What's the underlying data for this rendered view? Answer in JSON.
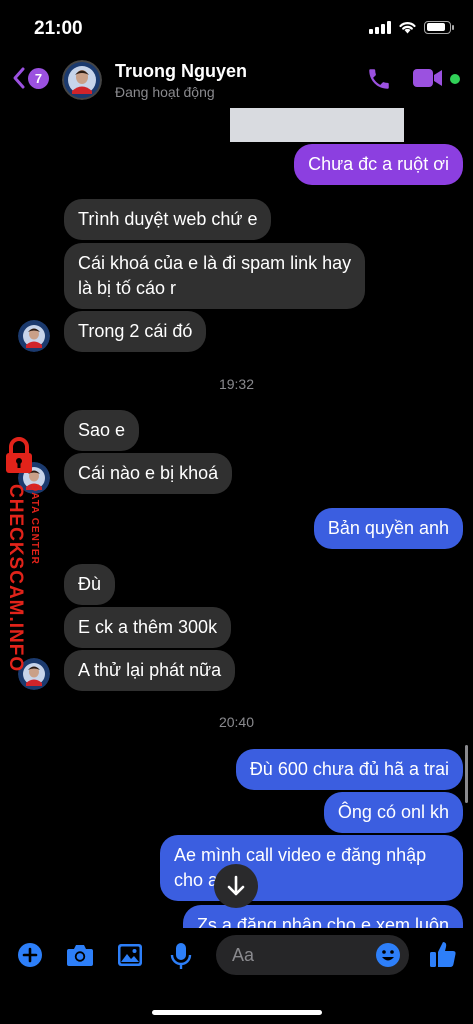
{
  "status_bar": {
    "time": "21:00"
  },
  "header": {
    "unread_count": "7",
    "contact_name": "Truong Nguyen",
    "contact_status": "Đang hoạt động"
  },
  "messages": [
    {
      "dir": "out",
      "color": "#8c3fe0",
      "text": "Chưa đc a ruột ơi"
    },
    {
      "dir": "in",
      "text": "Trình duyệt web chứ e"
    },
    {
      "dir": "in",
      "text": "Cái khoá của e là đi spam link hay",
      "text2": "là bị tố cáo r"
    },
    {
      "dir": "in",
      "text": "Trong 2 cái đó"
    },
    {
      "dir": "time",
      "text": "19:32"
    },
    {
      "dir": "in",
      "text": "Sao e"
    },
    {
      "dir": "in",
      "text": "Cái nào e bị khoá"
    },
    {
      "dir": "out",
      "color": "#3b5ee0",
      "text": "Bản quyền anh"
    },
    {
      "dir": "in",
      "text": "Đù"
    },
    {
      "dir": "in",
      "text": "E ck a thêm 300k"
    },
    {
      "dir": "in",
      "text": "A thử lại phát nữa"
    },
    {
      "dir": "time",
      "text": "20:40"
    },
    {
      "dir": "out",
      "color": "#3b5ee0",
      "text": "Đù 600 chưa đủ hã a trai"
    },
    {
      "dir": "out",
      "color": "#3b5ee0",
      "text": "Ông có onl kh"
    },
    {
      "dir": "out",
      "color": "#3b5ee0",
      "text": "Ae mình call video e đăng nhập",
      "text2": "cho anh"
    },
    {
      "dir": "out",
      "color": "#3b5ee0",
      "text": "Zs a đăng nhập cho e xem luôn"
    }
  ],
  "watermark": {
    "main": "CHECKSCAM.INFO",
    "sub": "DATA CENTER"
  },
  "composer": {
    "placeholder": "Aa"
  },
  "colors": {
    "accent": "#9b51e0",
    "outgoing_blue": "#3b5ee0",
    "outgoing_purple": "#8c3fe0",
    "incoming": "#303030",
    "online": "#31d158",
    "icon_blue": "#2d7ff9"
  },
  "icons": [
    "back-chevron-icon",
    "phone-icon",
    "video-camera-icon",
    "plus-icon",
    "camera-icon",
    "image-icon",
    "microphone-icon",
    "emoji-icon",
    "thumbs-up-icon",
    "arrow-down-icon",
    "lock-icon"
  ]
}
